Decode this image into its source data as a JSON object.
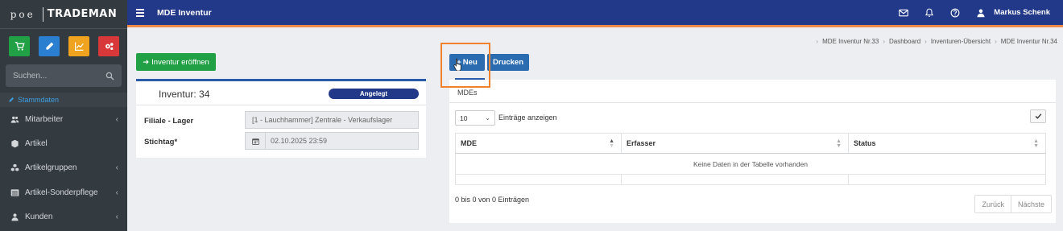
{
  "brand": {
    "prefix": "poe",
    "name": "TRADEMAN"
  },
  "sidebar": {
    "quick_buttons": [
      {
        "icon": "cart-icon",
        "color": "#22a045"
      },
      {
        "icon": "pencil-icon",
        "color": "#2b7fd0"
      },
      {
        "icon": "chart-icon",
        "color": "#f0a31e"
      },
      {
        "icon": "cogs-icon",
        "color": "#d9383a"
      }
    ],
    "search_placeholder": "Suchen...",
    "section": "Stammdaten",
    "items": [
      {
        "label": "Mitarbeiter",
        "icon": "users-icon",
        "has_children": true
      },
      {
        "label": "Artikel",
        "icon": "cube-icon",
        "has_children": false
      },
      {
        "label": "Artikelgruppen",
        "icon": "cubes-icon",
        "has_children": true
      },
      {
        "label": "Artikel-Sonderpflege",
        "icon": "list-icon",
        "has_children": true
      },
      {
        "label": "Kunden",
        "icon": "user-icon",
        "has_children": true
      }
    ]
  },
  "topbar": {
    "title": "MDE Inventur",
    "user": "Markus Schenk"
  },
  "breadcrumb": [
    "MDE Inventur Nr.33",
    "Dashboard",
    "Inventuren-Übersicht",
    "MDE Inventur Nr.34"
  ],
  "left": {
    "open_button": "Inventur eröffnen",
    "inventur_title": "Inventur: 34",
    "status_badge": "Angelegt",
    "filiale_label": "Filiale - Lager",
    "filiale_value": "[1 - Lauchhammer] Zentrale - Verkaufslager",
    "stichtag_label": "Stichtag*",
    "stichtag_value": "02.10.2025 23:59"
  },
  "right": {
    "neu_button": "Neu",
    "drucken_button": "Drucken",
    "tab": "MDEs",
    "page_length": "10",
    "page_length_label": "Einträge anzeigen",
    "columns": [
      "MDE",
      "Erfasser",
      "Status"
    ],
    "empty_message": "Keine Daten in der Tabelle vorhanden",
    "info": "0 bis 0 von 0 Einträgen",
    "prev": "Zurück",
    "next": "Nächste"
  },
  "colors": {
    "topbar": "#22398a",
    "accent_orange": "#f0812d",
    "sidebar": "#333a40",
    "primary_button": "#2b6cb0",
    "success_button": "#22a045"
  }
}
